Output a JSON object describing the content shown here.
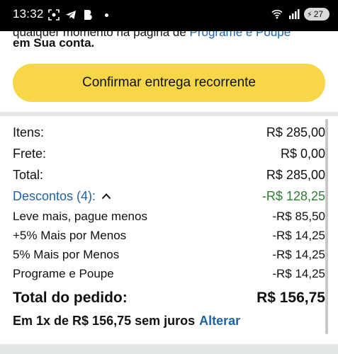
{
  "status_bar": {
    "time": "13:32",
    "battery": "27",
    "icons_left": [
      "screenshot-icon",
      "telegram-icon",
      "b-app-icon",
      "dot-icon"
    ],
    "icons_right": [
      "wifi-icon",
      "signal-icon",
      "battery-icon"
    ]
  },
  "notice": {
    "line1_text": "qualquer momento na página de ",
    "line1_link": "Programe e Poupe",
    "line2": "em Sua conta."
  },
  "confirm_button": {
    "label": "Confirmar entrega recorrente"
  },
  "summary": {
    "items_label": "Itens:",
    "items_value": "R$ 285,00",
    "shipping_label": "Frete:",
    "shipping_value": "R$ 0,00",
    "total_label": "Total:",
    "total_value": "R$ 285,00",
    "discounts_label": "Descontos (4):",
    "discounts_value": "-R$ 128,25",
    "discounts": [
      {
        "label": "Leve mais, pague menos",
        "value": "-R$ 85,50"
      },
      {
        "label": "+5% Mais por Menos",
        "value": "-R$ 14,25"
      },
      {
        "label": "5% Mais por Menos",
        "value": "-R$ 14,25"
      },
      {
        "label": "Programe e Poupe",
        "value": "-R$ 14,25"
      }
    ],
    "order_total_label": "Total do pedido:",
    "order_total_value": "R$ 156,75",
    "installment_text": "Em 1x de R$ 156,75 sem juros",
    "installment_link": "Alterar"
  },
  "colors": {
    "button": "#f7d748",
    "link": "#2162a1",
    "discount": "#2e7d32",
    "divider": "#e3e6e6"
  }
}
